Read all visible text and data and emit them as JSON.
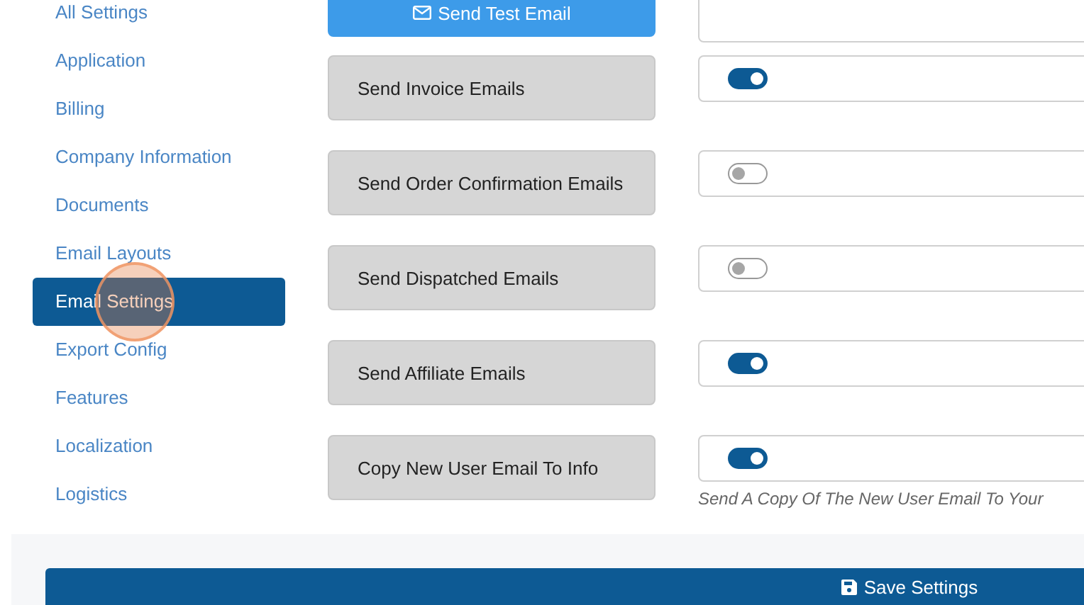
{
  "sidebar": {
    "items": [
      {
        "label": "All Settings",
        "selected": false
      },
      {
        "label": "Application",
        "selected": false
      },
      {
        "label": "Billing",
        "selected": false
      },
      {
        "label": "Company Information",
        "selected": false
      },
      {
        "label": "Documents",
        "selected": false
      },
      {
        "label": "Email Layouts",
        "selected": false
      },
      {
        "label": "Email Settings",
        "selected": true,
        "click_marker": true
      },
      {
        "label": "Export Config",
        "selected": false
      },
      {
        "label": "Features",
        "selected": false
      },
      {
        "label": "Localization",
        "selected": false
      },
      {
        "label": "Logistics",
        "selected": false
      }
    ]
  },
  "send_test_button": "Send Test Email",
  "settings": [
    {
      "label": "Send Invoice Emails",
      "on": true
    },
    {
      "label": "Send Order Confirmation Emails",
      "on": false
    },
    {
      "label": "Send Dispatched Emails",
      "on": false
    },
    {
      "label": "Send Affiliate Emails",
      "on": true
    },
    {
      "label": "Copy New User Email To Info",
      "on": true,
      "hint": "Send A Copy Of The New User Email To Your"
    }
  ],
  "save_button": "Save Settings"
}
